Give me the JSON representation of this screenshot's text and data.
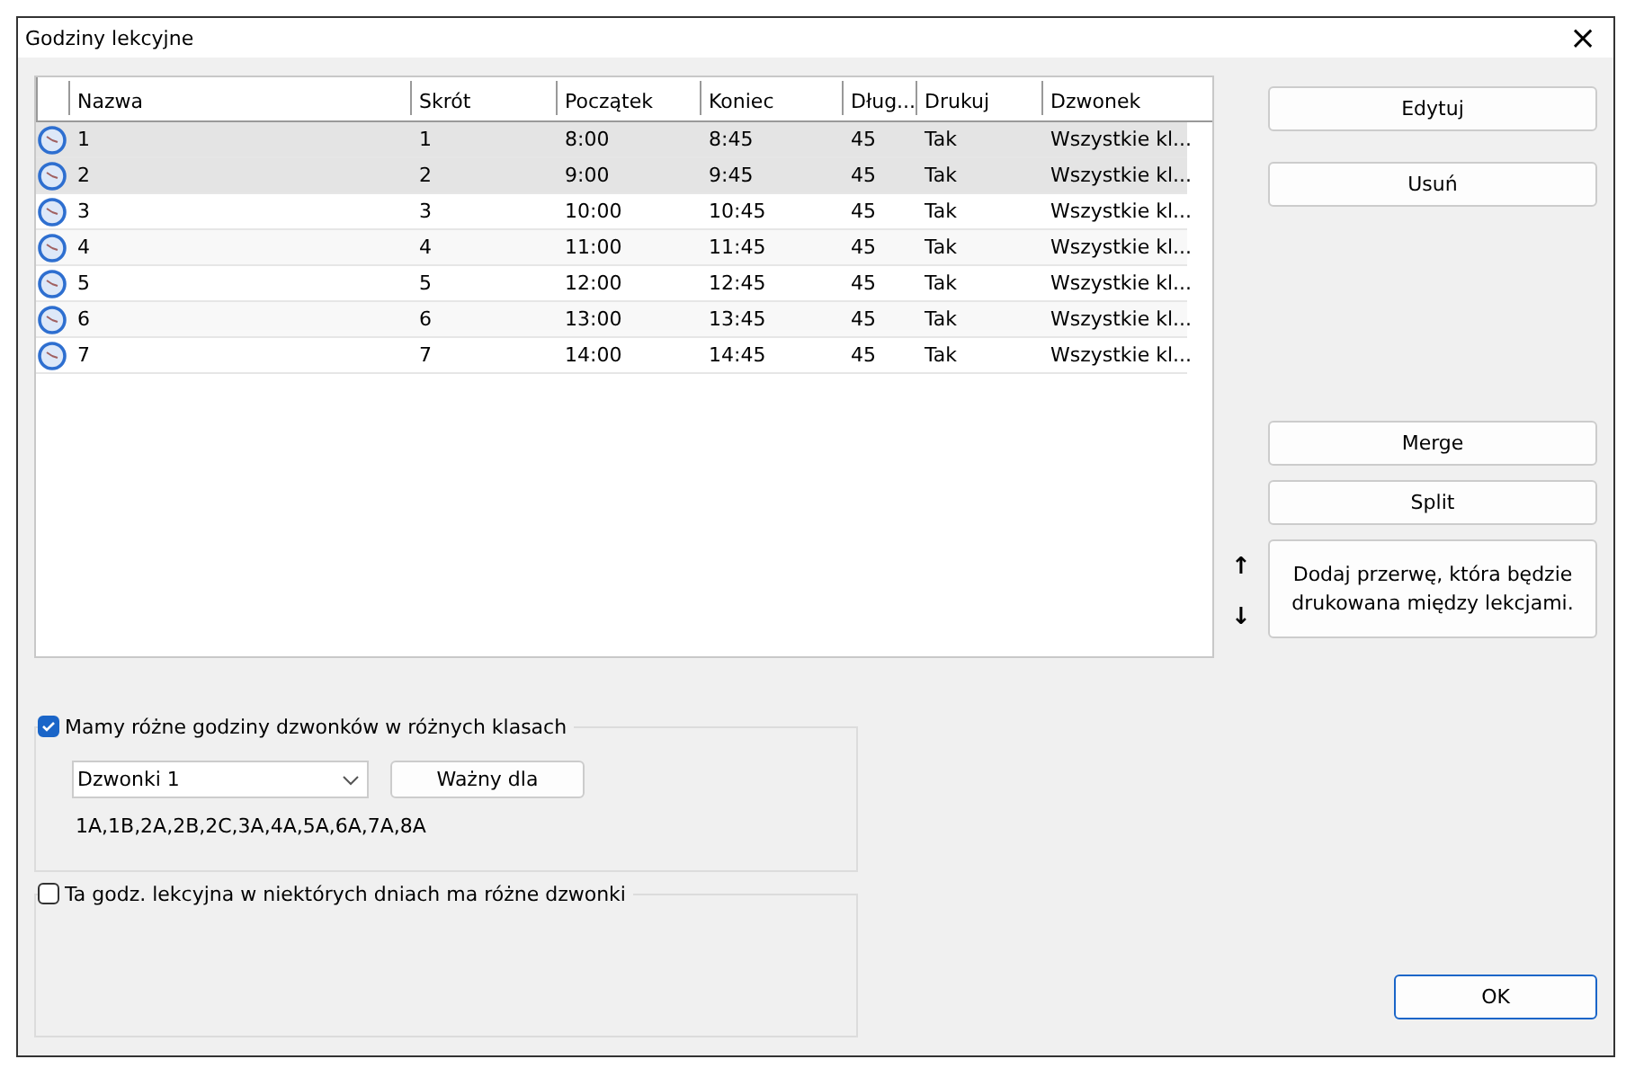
{
  "window": {
    "title": "Godziny lekcyjne",
    "close": "×"
  },
  "table": {
    "columns": [
      "Nazwa",
      "Skrót",
      "Początek",
      "Koniec",
      "Dług...",
      "Drukuj",
      "Dzwonek"
    ],
    "rows": [
      {
        "selected": true,
        "cells": [
          "1",
          "1",
          "8:00",
          "8:45",
          "45",
          "Tak",
          "Wszystkie kl..."
        ]
      },
      {
        "selected": true,
        "cells": [
          "2",
          "2",
          "9:00",
          "9:45",
          "45",
          "Tak",
          "Wszystkie kl..."
        ]
      },
      {
        "selected": false,
        "cells": [
          "3",
          "3",
          "10:00",
          "10:45",
          "45",
          "Tak",
          "Wszystkie kl..."
        ]
      },
      {
        "selected": false,
        "cells": [
          "4",
          "4",
          "11:00",
          "11:45",
          "45",
          "Tak",
          "Wszystkie kl..."
        ]
      },
      {
        "selected": false,
        "cells": [
          "5",
          "5",
          "12:00",
          "12:45",
          "45",
          "Tak",
          "Wszystkie kl..."
        ]
      },
      {
        "selected": false,
        "cells": [
          "6",
          "6",
          "13:00",
          "13:45",
          "45",
          "Tak",
          "Wszystkie kl..."
        ]
      },
      {
        "selected": false,
        "cells": [
          "7",
          "7",
          "14:00",
          "14:45",
          "45",
          "Tak",
          "Wszystkie kl..."
        ]
      }
    ]
  },
  "buttons_top": [
    "Edytuj",
    "Usuń"
  ],
  "buttons_mid": [
    "Merge",
    "Split"
  ],
  "move_up": "↑",
  "move_down": "↓",
  "add_break_button": "Dodaj przerwę, która będzie drukowana między lekcjami.",
  "class_bells": {
    "checked": true,
    "label": "Mamy różne godziny dzwonków w różnych klasach",
    "dropdown": "Dzwonki 1",
    "valid_for_button": "Ważny dla",
    "classes": "1A,1B,2A,2B,2C,3A,4A,5A,6A,7A,8A"
  },
  "day_bells": {
    "checked": false,
    "label": "Ta godz. lekcyjna w niektórych dniach ma różne dzwonki"
  },
  "ok_button": "OK"
}
